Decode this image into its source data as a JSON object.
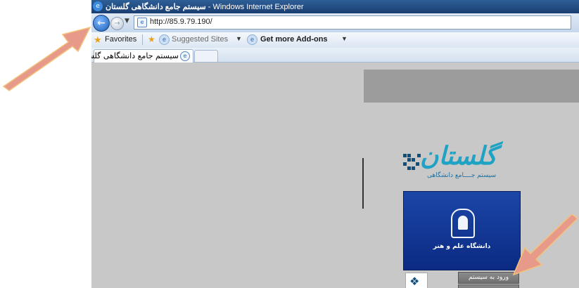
{
  "browser": {
    "title_fa": "سیستم جامع دانشگاهی گلستان",
    "title_suffix": " - Windows Internet Explorer",
    "url": "http://85.9.79.190/",
    "favorites_label": "Favorites",
    "suggested_sites_label": "Suggested Sites",
    "addons_label": "Get more Add-ons",
    "tab_title": "سیستم جامع دانشگاهی گلستان"
  },
  "page": {
    "logo_sub": "سیستم جــــامع دانشگاهی",
    "university_label": "دانشگاه علم و هنر",
    "login_button": "ورود به سیستم"
  },
  "annotations": {
    "arrow_color": "#e89a8a",
    "arrow_count": 2
  },
  "colors": {
    "content_bg": "#c8c8c8",
    "banner": "#9c9c9c",
    "uni_box": "#1b46a8",
    "logo_teal": "#1ea3c4"
  }
}
